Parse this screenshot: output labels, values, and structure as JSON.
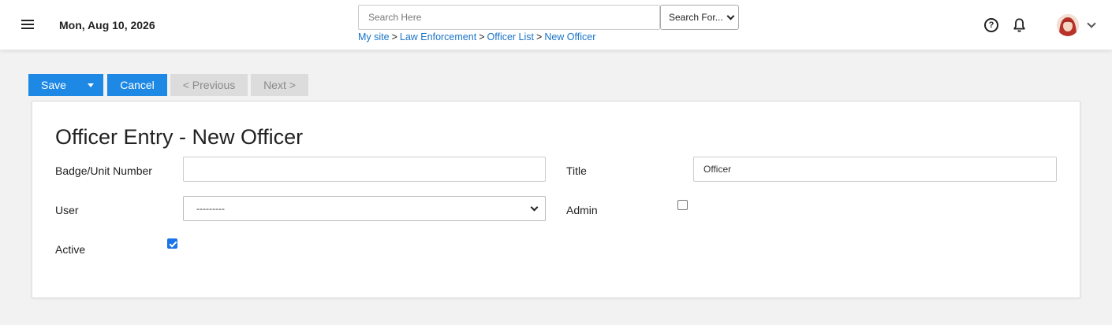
{
  "header": {
    "date": "Mon, Aug 10, 2026",
    "search": {
      "placeholder": "Search Here",
      "value": ""
    },
    "search_for": {
      "selected": "Search For..."
    },
    "breadcrumb": [
      {
        "label": "My site"
      },
      {
        "label": "Law Enforcement"
      },
      {
        "label": "Officer List"
      },
      {
        "label": "New Officer"
      }
    ],
    "breadcrumb_separator": ">",
    "help_icon_glyph": "?"
  },
  "toolbar": {
    "save_label": "Save",
    "cancel_label": "Cancel",
    "previous_label": "< Previous",
    "next_label": "Next >"
  },
  "form": {
    "title": "Officer Entry - New Officer",
    "badge": {
      "label": "Badge/Unit Number",
      "value": ""
    },
    "title_field": {
      "label": "Title",
      "value": "Officer"
    },
    "user": {
      "label": "User",
      "selected": "---------"
    },
    "admin": {
      "label": "Admin",
      "checked": false
    },
    "active": {
      "label": "Active",
      "checked": true
    }
  },
  "colors": {
    "accent": "#1e88e5",
    "link": "#1a73c7",
    "disabled_button": "#dcdcdc",
    "page_background": "#f2f2f2"
  },
  "icons": [
    "menu-icon",
    "help-icon",
    "bell-icon",
    "avatar",
    "chevron-down-icon",
    "caret-down-icon",
    "checkmark-icon"
  ]
}
